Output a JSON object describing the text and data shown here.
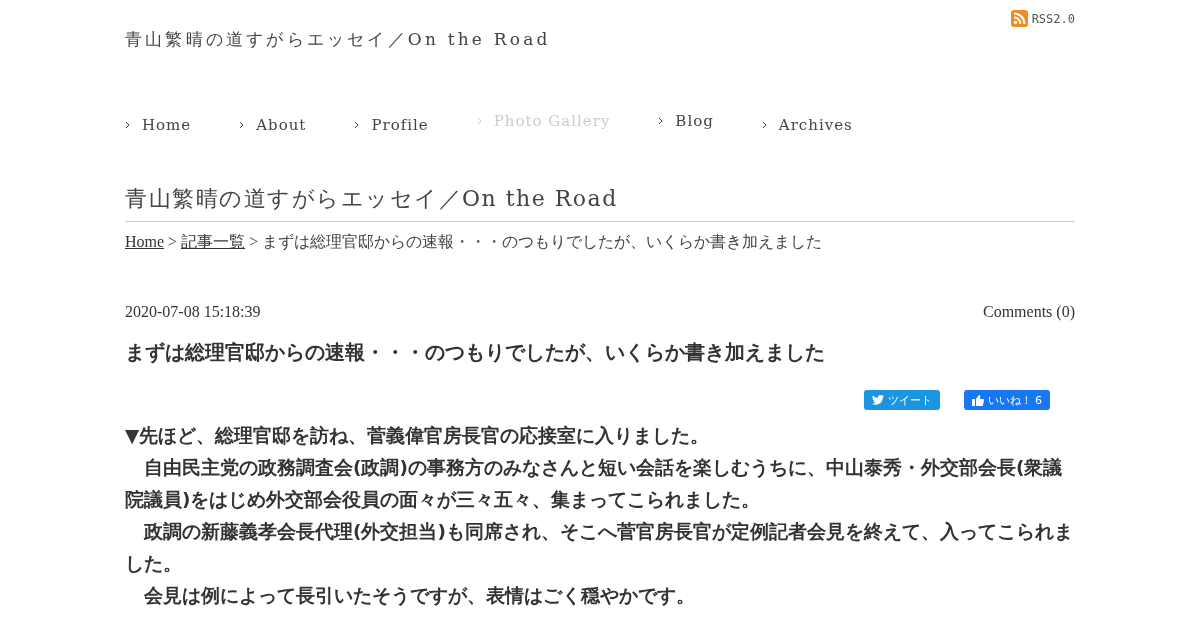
{
  "site_title": "青山繁晴の道すがらエッセイ／On the Road",
  "rss": {
    "label": "RSS2.0"
  },
  "nav": [
    {
      "label": "Home",
      "disabled": false
    },
    {
      "label": "About",
      "disabled": false
    },
    {
      "label": "Profile",
      "disabled": false
    },
    {
      "label": "Photo Gallery",
      "disabled": true
    },
    {
      "label": "Blog",
      "disabled": false
    },
    {
      "label": "Archives",
      "disabled": false
    }
  ],
  "page_title": "青山繁晴の道すがらエッセイ／On the Road",
  "breadcrumb": [
    {
      "label": "Home",
      "kind": "link"
    },
    {
      "label": "記事一覧",
      "kind": "link"
    },
    {
      "label": "まずは総理官邸からの速報・・・のつもりでしたが、いくらか書き加えました",
      "kind": "current"
    }
  ],
  "breadcrumb_separator": ">",
  "post": {
    "date": "2020-07-08 15:18:39",
    "comments": "Comments (0)",
    "title": "まずは総理官邸からの速報・・・のつもりでしたが、いくらか書き加えました",
    "tweet": "ツイート",
    "like": "いいね！ 6",
    "paragraphs": [
      "▼先ほど、総理官邸を訪ね、菅義偉官房長官の応接室に入りました。",
      "　自由民主党の政務調査会(政調)の事務方のみなさんと短い会話を楽しむうちに、中山泰秀・外交部会長(衆議院議員)をはじめ外交部会役員の面々が三々五々、集まってこられました。",
      "　政調の新藤義孝会長代理(外交担当)も同席され、そこへ菅官房長官が定例記者会見を終えて、入ってこられました。",
      "　会見は例によって長引いたそうですが、表情はごく穏やかです。"
    ]
  }
}
